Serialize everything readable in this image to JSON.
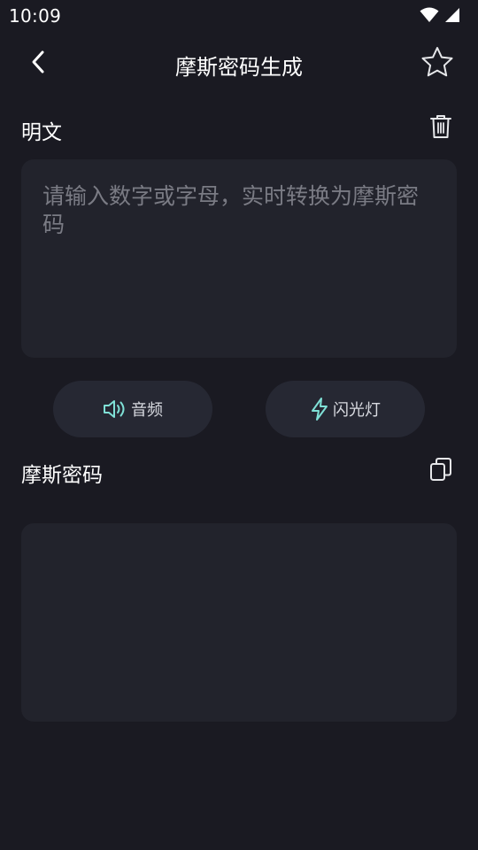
{
  "status_bar": {
    "time": "10:09",
    "icons": [
      "wifi-icon",
      "cell-signal-icon"
    ]
  },
  "app_bar": {
    "title": "摩斯密码生成",
    "back_icon": "chevron-left-icon",
    "favorite_icon": "star-outline-icon"
  },
  "plaintext": {
    "label": "明文",
    "clear_icon": "trash-icon",
    "input_value": "",
    "input_placeholder": "请输入数字或字母，实时转换为摩斯密码"
  },
  "actions": {
    "audio_label": "音频",
    "audio_icon": "speaker-icon",
    "flash_label": "闪光灯",
    "flash_icon": "lightning-icon"
  },
  "morse": {
    "label": "摩斯密码",
    "copy_icon": "copy-icon",
    "output_value": ""
  },
  "colors": {
    "background": "#1a1a22",
    "card": "#22232c",
    "pill": "#262833",
    "accent_icon": "#7fe0d6",
    "placeholder": "#7a7b84"
  }
}
